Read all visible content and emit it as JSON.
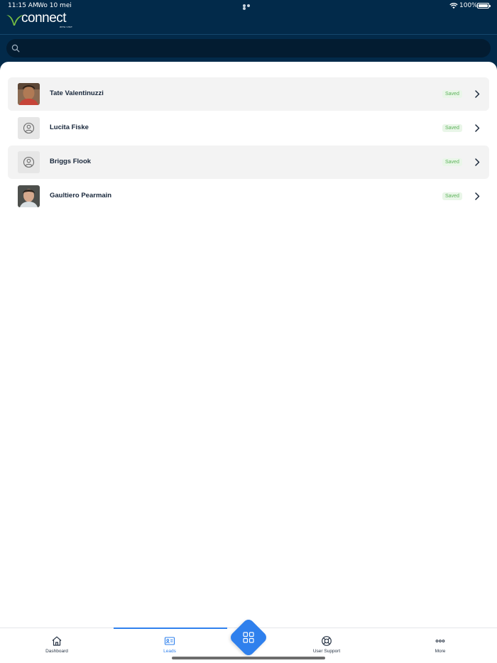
{
  "status_bar": {
    "time": "11:15 AM",
    "date": "Wo 10 mei",
    "battery": "100%"
  },
  "header": {
    "logo_text": "connect",
    "logo_subtext": "WITH VISIT",
    "brand_color": "#7ac143"
  },
  "search": {
    "placeholder": "",
    "value": ""
  },
  "leads": [
    {
      "name": "Tate Valentinuzzi",
      "status": "Saved",
      "avatar": "photo-man"
    },
    {
      "name": "Lucita Fiske",
      "status": "Saved",
      "avatar": "placeholder-user-icon"
    },
    {
      "name": "Briggs Flook",
      "status": "Saved",
      "avatar": "placeholder-user-icon"
    },
    {
      "name": "Gaultiero Pearmain",
      "status": "Saved",
      "avatar": "photo-woman"
    }
  ],
  "tabs": [
    {
      "label": "Dashboard",
      "icon": "home-icon"
    },
    {
      "label": "Leads",
      "icon": "id-card-icon",
      "active": true
    },
    {
      "label": "Scan",
      "icon": "qr-scan-icon"
    },
    {
      "label": "User Support",
      "icon": "lifebuoy-icon"
    },
    {
      "label": "More",
      "icon": "more-dots-icon"
    }
  ],
  "colors": {
    "header_bg": "#022a4a",
    "accent": "#2f80ed",
    "saved_text": "#5db25a",
    "saved_bg": "#e9f6e8"
  }
}
